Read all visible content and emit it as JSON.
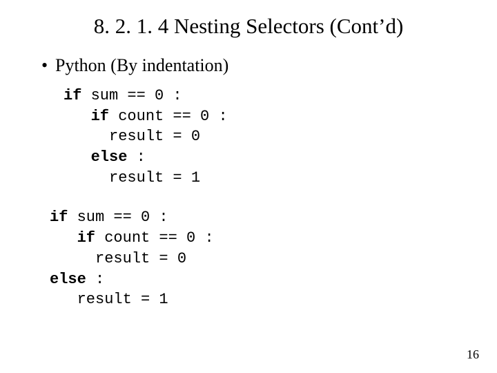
{
  "title": "8. 2. 1. 4 Nesting Selectors (Cont’d)",
  "bullet": "Python (By indentation)",
  "code1": {
    "l1a": "if",
    "l1b": " sum == 0 :",
    "l2a": "   if",
    "l2b": " count == 0 :",
    "l3": "     result = 0",
    "l4a": "   else",
    "l4b": " :",
    "l5": "     result = 1"
  },
  "code2": {
    "l1a": "if",
    "l1b": " sum == 0 :",
    "l2a": "   if",
    "l2b": " count == 0 :",
    "l3": "     result = 0",
    "l4a": "else",
    "l4b": " :",
    "l5": "   result = 1"
  },
  "page_number": "16"
}
